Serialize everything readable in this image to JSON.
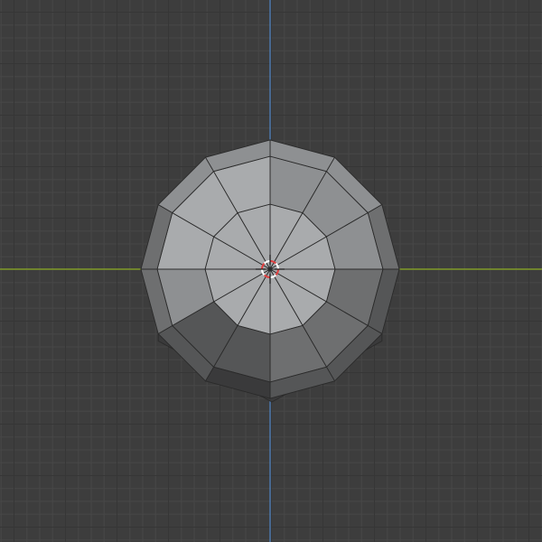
{
  "viewport": {
    "view": "top-orthographic",
    "background_color": "#3d3d3d",
    "grid_minor_color": "#474747",
    "grid_major_color": "#363636"
  },
  "axes": {
    "x_axis_color": "#8fb026",
    "y_axis_color": "#4f86c6"
  },
  "object": {
    "type": "uv-sphere",
    "segments": 12,
    "visible_rings": 3,
    "edge_color": "#2a2a2a",
    "face_colors": {
      "bright": "#a9abad",
      "mid": "#8e9092",
      "dark": "#6e6f70",
      "darker": "#555657",
      "darkest": "#3a3a3b"
    }
  },
  "cursor_3d": {
    "icon": "3d-cursor-icon",
    "ring_color_a": "#e04040",
    "ring_color_b": "#ffffff"
  },
  "origin": {
    "icon": "origin-dot-icon",
    "color": "#2a2a2a"
  }
}
